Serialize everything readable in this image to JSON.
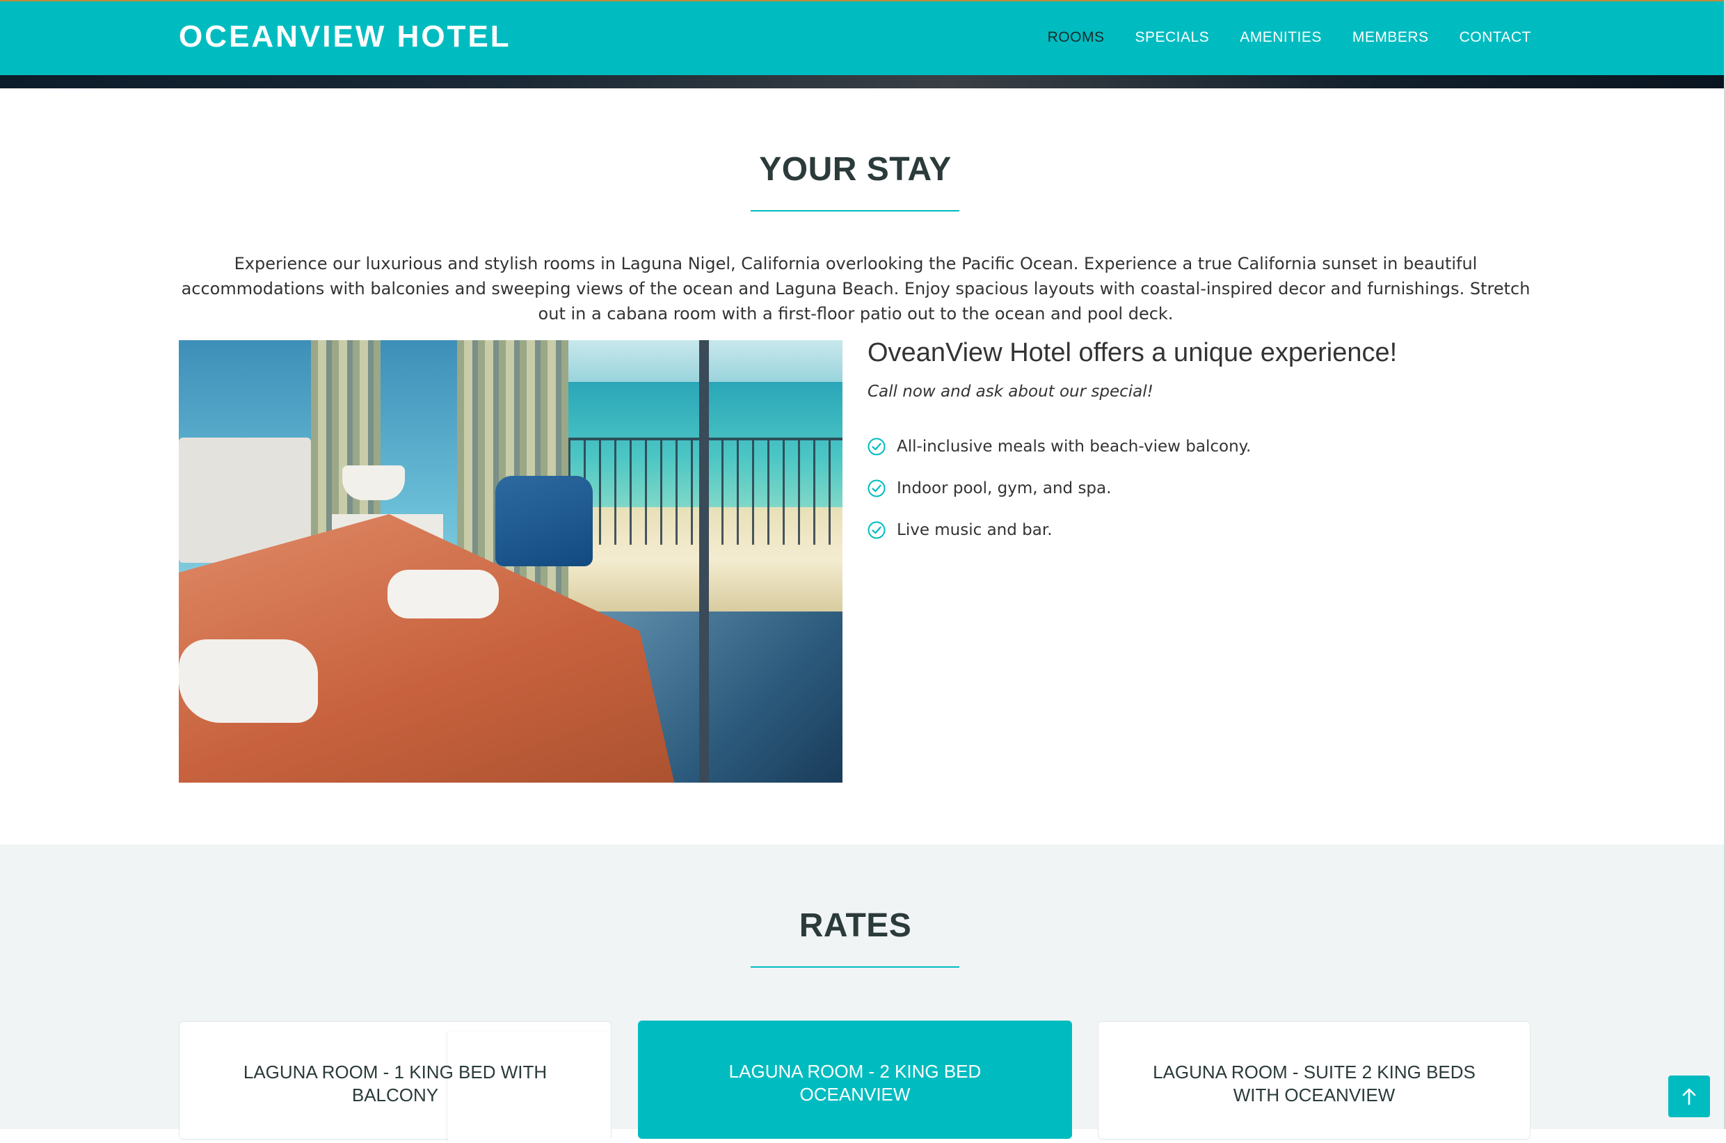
{
  "header": {
    "brand": "OCEANVIEW HOTEL",
    "nav": [
      {
        "label": "ROOMS",
        "active": true
      },
      {
        "label": "SPECIALS"
      },
      {
        "label": "AMENITIES"
      },
      {
        "label": "MEMBERS"
      },
      {
        "label": "CONTACT"
      }
    ]
  },
  "stay": {
    "title": "YOUR STAY",
    "intro": "Experience our luxurious and stylish rooms in Laguna Nigel, California overlooking the Pacific Ocean. Experience a true California sunset in beautiful accommodations with balconies and sweeping views of the ocean and Laguna Beach. Enjoy spacious layouts with coastal-inspired decor and furnishings. Stretch out in a cabana room with a first-floor patio out to the ocean and pool deck.",
    "offer_title": "OveanView Hotel offers a unique experience!",
    "offer_subtitle": "Call now and ask about our special!",
    "features": [
      "All-inclusive meals with beach-view balcony.",
      "Indoor pool, gym, and spa.",
      "Live music and bar."
    ]
  },
  "rates": {
    "title": "RATES",
    "cards": [
      {
        "name": "LAGUNA ROOM - 1 KING BED WITH BALCONY"
      },
      {
        "name": "LAGUNA ROOM - 2 KING BED OCEANVIEW",
        "featured": true
      },
      {
        "name": "LAGUNA ROOM - SUITE 2 KING BEDS WITH OCEANVIEW"
      }
    ]
  },
  "colors": {
    "accent": "#00bcc0",
    "heading": "#2b3a3a",
    "rates_bg": "#f1f4f4"
  }
}
